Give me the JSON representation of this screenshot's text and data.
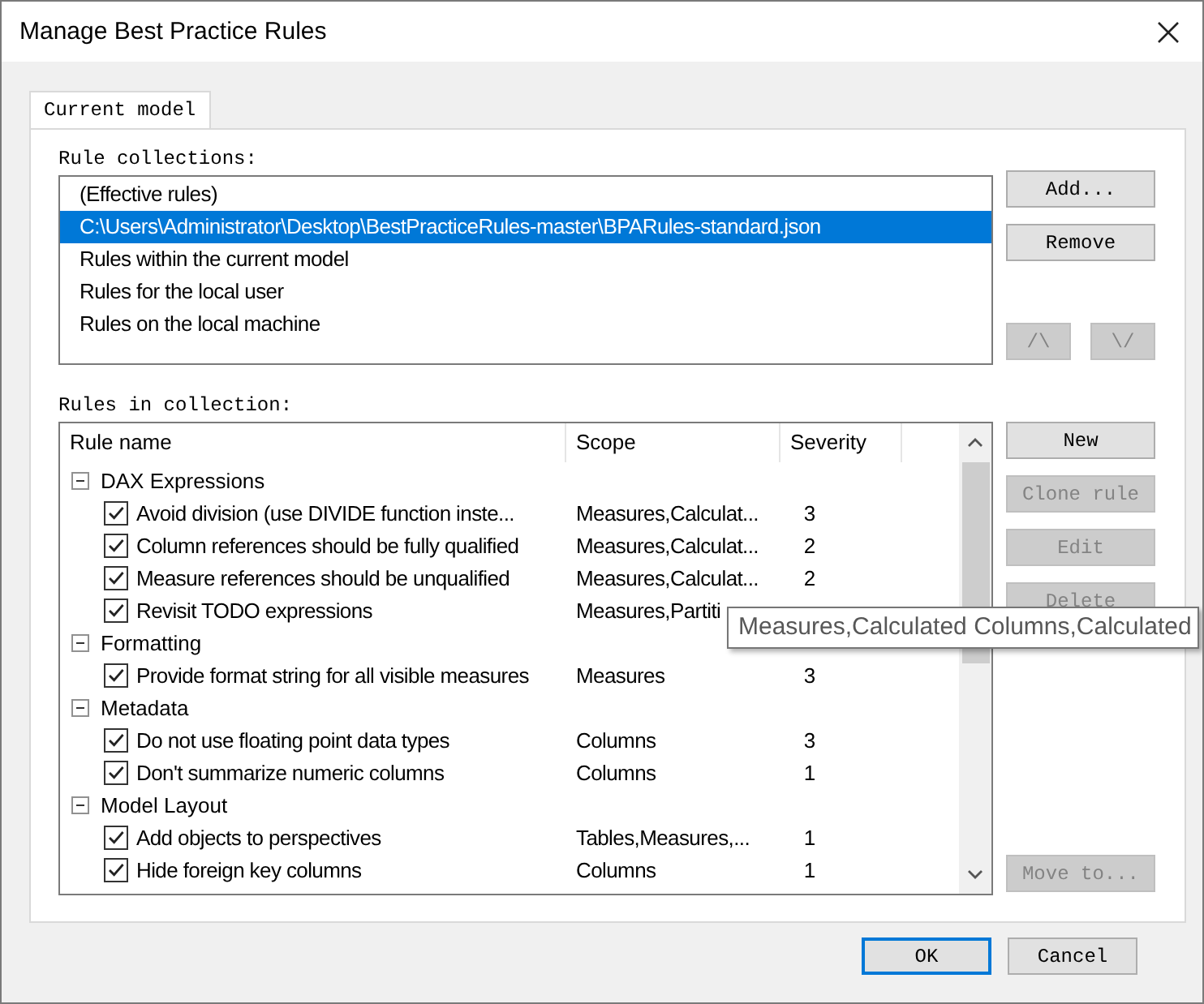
{
  "window": {
    "title": "Manage Best Practice Rules"
  },
  "tabs": [
    {
      "label": "Current model",
      "selected": true
    }
  ],
  "collections": {
    "label": "Rule collections:",
    "items": [
      {
        "text": "(Effective rules)",
        "selected": false
      },
      {
        "text": "C:\\Users\\Administrator\\Desktop\\BestPracticeRules-master\\BPARules-standard.json",
        "selected": true
      },
      {
        "text": "Rules within the current model",
        "selected": false
      },
      {
        "text": "Rules for the local user",
        "selected": false
      },
      {
        "text": "Rules on the local machine",
        "selected": false
      }
    ],
    "buttons": [
      {
        "label": "Add...",
        "disabled": false
      },
      {
        "label": "Remove",
        "disabled": false
      }
    ],
    "move_buttons": [
      {
        "label": "/\\",
        "disabled": true
      },
      {
        "label": "\\/",
        "disabled": true
      }
    ]
  },
  "rules": {
    "label": "Rules in collection:",
    "columns": [
      "Rule name",
      "Scope",
      "Severity"
    ],
    "groups": [
      {
        "name": "DAX Expressions",
        "expanded": true,
        "children": [
          {
            "name": "Avoid division (use DIVIDE function inste...",
            "scope": "Measures,Calculat...",
            "severity": "3",
            "checked": true
          },
          {
            "name": "Column references should be fully qualified",
            "scope": "Measures,Calculat...",
            "severity": "2",
            "checked": true
          },
          {
            "name": "Measure references should be unqualified",
            "scope": "Measures,Calculat...",
            "severity": "2",
            "checked": true
          },
          {
            "name": "Revisit TODO expressions",
            "scope": "Measures,Partiti",
            "checked": true
          }
        ]
      },
      {
        "name": "Formatting",
        "expanded": true,
        "children": [
          {
            "name": "Provide format string for all visible measures",
            "scope": "Measures",
            "severity": "3",
            "checked": true
          }
        ]
      },
      {
        "name": "Metadata",
        "expanded": true,
        "children": [
          {
            "name": "Do not use floating point data types",
            "scope": "Columns",
            "severity": "3",
            "checked": true
          },
          {
            "name": "Don't summarize numeric columns",
            "scope": "Columns",
            "severity": "1",
            "checked": true
          }
        ]
      },
      {
        "name": "Model Layout",
        "expanded": true,
        "children": [
          {
            "name": "Add objects to perspectives",
            "scope": "Tables,Measures,...",
            "severity": "1",
            "checked": true
          },
          {
            "name": "Hide foreign key columns",
            "scope": "Columns",
            "severity": "1",
            "checked": true
          }
        ]
      }
    ],
    "buttons": [
      {
        "label": "New",
        "disabled": false
      },
      {
        "label": "Clone rule",
        "disabled": true
      },
      {
        "label": "Edit",
        "disabled": true
      },
      {
        "label": "Delete",
        "disabled": true
      }
    ],
    "move_button": {
      "label": "Move to...",
      "disabled": true
    },
    "tooltip": "Measures,Calculated Columns,Calculated"
  },
  "footer_buttons": [
    {
      "label": "OK",
      "default": true
    },
    {
      "label": "Cancel",
      "default": false
    }
  ]
}
